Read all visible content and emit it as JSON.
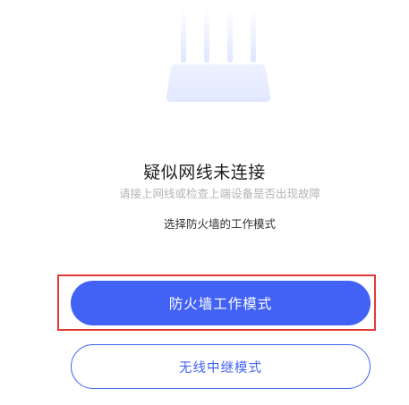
{
  "status": {
    "title": "疑似网线未连接",
    "subtitle": "请接上网线或检查上端设备是否出现故障",
    "instruction": "选择防火墙的工作模式"
  },
  "modes": {
    "firewall_label": "防火墙工作模式",
    "repeater_label": "无线中继模式"
  },
  "colors": {
    "primary": "#4162f5",
    "highlight": "#e53935",
    "illustration": "#e8edff"
  },
  "icons": {
    "illustration": "router-icon"
  }
}
